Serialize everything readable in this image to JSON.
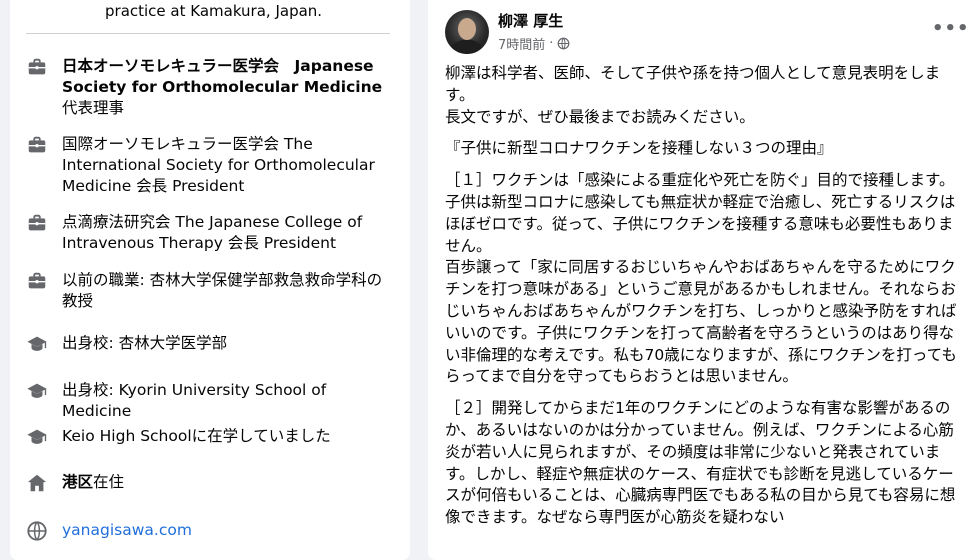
{
  "intro": {
    "tail": "practice at Kamakura, Japan.",
    "items": [
      {
        "icon": "briefcase-icon",
        "bold": "日本オーソモレキュラー医学会　Japanese Society for Orthomolecular Medicine",
        "rest": " 代表理事"
      },
      {
        "icon": "briefcase-icon",
        "bold": "",
        "rest": "国際オーソモレキュラー医学会 The International Society for Orthomolecular Medicine 会長 President"
      },
      {
        "icon": "briefcase-icon",
        "bold": "",
        "rest": "点滴療法研究会 The Japanese College of Intravenous Therapy 会長 President"
      },
      {
        "icon": "briefcase-icon",
        "bold": "",
        "rest": "以前の職業: 杏林大学保健学部救急救命学科の教授"
      },
      {
        "icon": "graduation-cap-icon",
        "bold": "",
        "rest": "出身校: 杏林大学医学部"
      },
      {
        "icon": "graduation-cap-icon",
        "bold": "",
        "rest": "出身校: Kyorin University School of Medicine"
      },
      {
        "icon": "graduation-cap-icon",
        "bold": "",
        "rest": "Keio High Schoolに在学していました"
      },
      {
        "icon": "home-icon",
        "bold": "港区",
        "rest": "在住"
      },
      {
        "icon": "globe-icon",
        "bold": "",
        "rest": "yanagisawa.com",
        "link": true
      }
    ]
  },
  "post": {
    "author": "柳澤 厚生",
    "time": "7時間前",
    "dot": "·",
    "more": "•••",
    "paragraphs": [
      "柳澤は科学者、医師、そして子供や孫を持つ個人として意見表明をします。\n長文ですが、ぜひ最後までお読みください。",
      "『子供に新型コロナワクチンを接種しない３つの理由』",
      "［１］ワクチンは「感染による重症化や死亡を防ぐ」目的で接種します。子供は新型コロナに感染しても無症状か軽症で治癒し、死亡するリスクはほぼゼロです。従って、子供にワクチンを接種する意味も必要性もありません。\n百歩譲って「家に同居するおじいちゃんやおばあちゃんを守るためにワクチンを打つ意味がある」というご意見があるかもしれません。それならおじいちゃんおばあちゃんがワクチンを打ち、しっかりと感染予防をすればいいのです。子供にワクチンを打って高齢者を守ろうというのはあり得ない非倫理的な考えです。私も70歳になりますが、孫にワクチンを打ってもらってまで自分を守ってもらおうとは思いません。",
      "［２］開発してからまだ1年のワクチンにどのような有害な影響があるのか、あるいはないのかは分かっていません。例えば、ワクチンによる心筋炎が若い人に見られますが、その頻度は非常に少ないと発表されています。しかし、軽症や無症状のケース、有症状でも診断を見逃しているケースが何倍もいることは、心臓病専門医でもある私の目から見ても容易に想像できます。なぜなら専門医が心筋炎を疑わない"
    ]
  },
  "colors": {
    "link": "#216fdb",
    "muted": "#65676b",
    "icon": "#65676b"
  }
}
